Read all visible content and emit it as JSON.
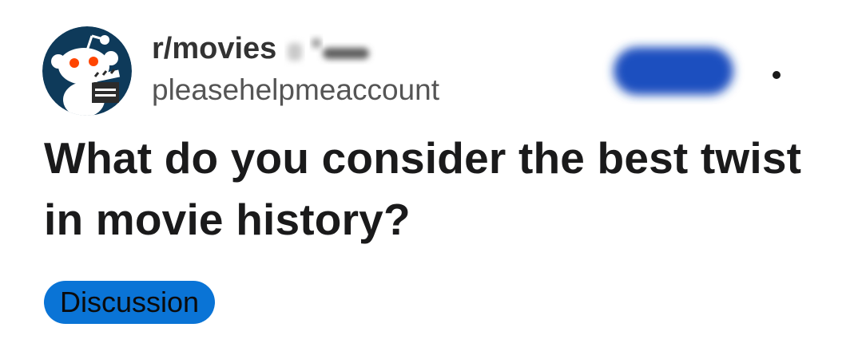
{
  "post": {
    "subreddit": "r/movies",
    "username": "pleasehelpmeaccount",
    "title": "What do you consider the best twist in movie history?",
    "flair": "Discussion"
  },
  "icons": {
    "avatar": "reddit-snoo-clapperboard-icon",
    "more": "more-options-icon"
  },
  "colors": {
    "flair_bg": "#0a74d6",
    "join_blob": "#1f4fbf",
    "avatar_bg": "#0e3a5a"
  }
}
